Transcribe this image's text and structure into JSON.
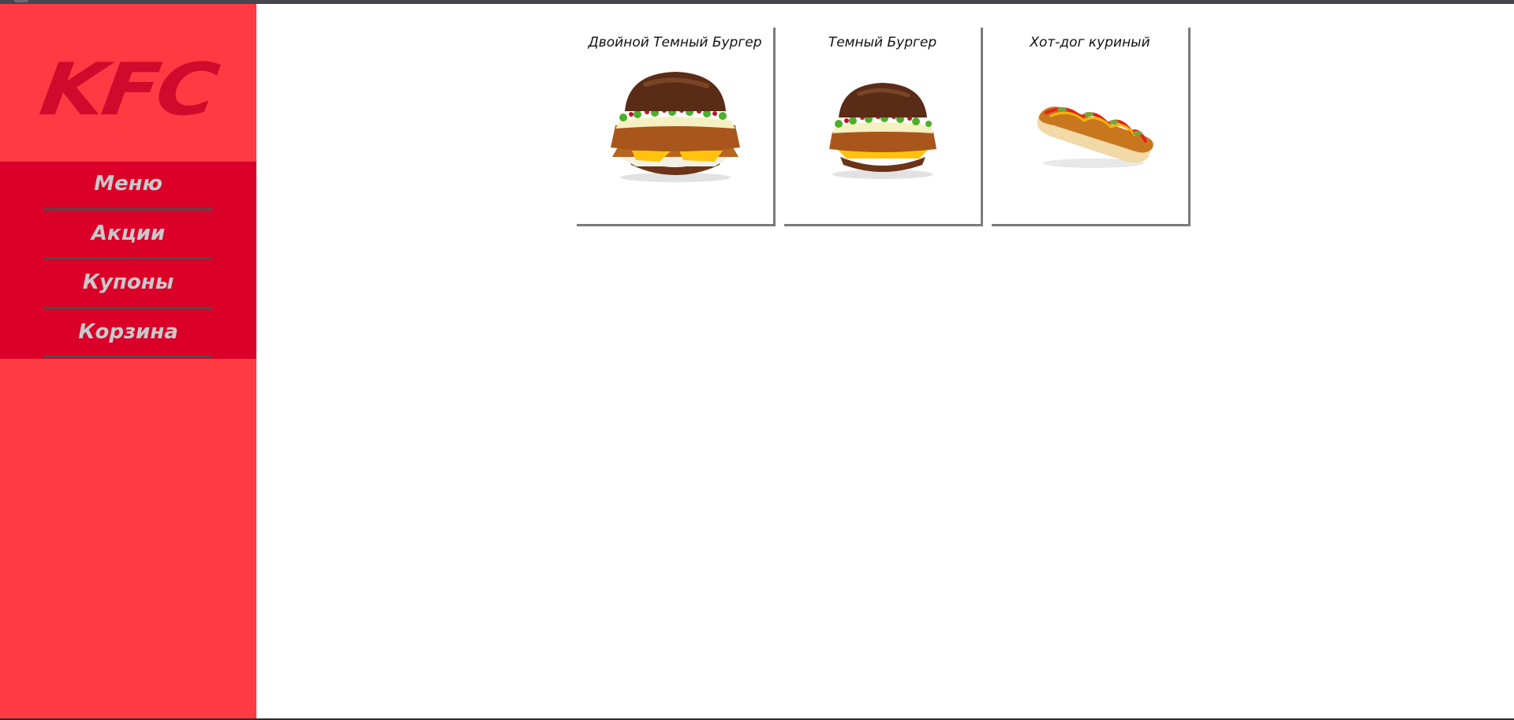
{
  "brand": {
    "logo_text": "KFC",
    "sidebar_color": "#fe3a43",
    "nav_color": "#da0028",
    "logo_color": "#cf0a2c"
  },
  "sidebar": {
    "items": [
      {
        "label": "Меню"
      },
      {
        "label": "Акции"
      },
      {
        "label": "Купоны"
      },
      {
        "label": "Корзина"
      }
    ]
  },
  "products": [
    {
      "name": "Двойной Темный Бургер",
      "image": "double-dark-burger-image"
    },
    {
      "name": "Темный Бургер",
      "image": "dark-burger-image"
    },
    {
      "name": "Хот-дог куриный",
      "image": "chicken-hotdog-image"
    }
  ]
}
